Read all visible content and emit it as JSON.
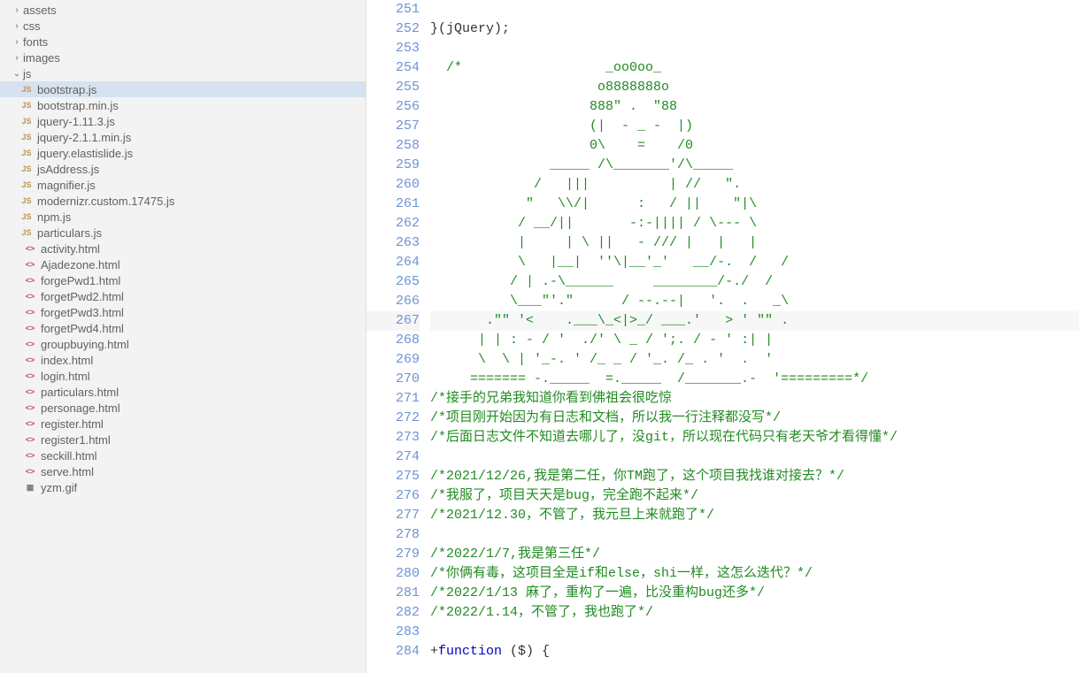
{
  "sidebar": {
    "items": [
      {
        "type": "folder",
        "state": "collapsed",
        "label": "assets",
        "indent": 1
      },
      {
        "type": "folder",
        "state": "collapsed",
        "label": "css",
        "indent": 1
      },
      {
        "type": "folder",
        "state": "collapsed",
        "label": "fonts",
        "indent": 1
      },
      {
        "type": "folder",
        "state": "collapsed",
        "label": "images",
        "indent": 1
      },
      {
        "type": "folder",
        "state": "expanded",
        "label": "js",
        "indent": 1
      },
      {
        "type": "file",
        "icon": "js",
        "label": "bootstrap.js",
        "indent": 2,
        "selected": true
      },
      {
        "type": "file",
        "icon": "js",
        "label": "bootstrap.min.js",
        "indent": 2
      },
      {
        "type": "file",
        "icon": "js",
        "label": "jquery-1.11.3.js",
        "indent": 2
      },
      {
        "type": "file",
        "icon": "js",
        "label": "jquery-2.1.1.min.js",
        "indent": 2
      },
      {
        "type": "file",
        "icon": "js",
        "label": "jquery.elastislide.js",
        "indent": 2
      },
      {
        "type": "file",
        "icon": "js",
        "label": "jsAddress.js",
        "indent": 2
      },
      {
        "type": "file",
        "icon": "js",
        "label": "magnifier.js",
        "indent": 2
      },
      {
        "type": "file",
        "icon": "js",
        "label": "modernizr.custom.17475.js",
        "indent": 2
      },
      {
        "type": "file",
        "icon": "js",
        "label": "npm.js",
        "indent": 2
      },
      {
        "type": "file",
        "icon": "js",
        "label": "particulars.js",
        "indent": 2
      },
      {
        "type": "file",
        "icon": "html",
        "label": "activity.html",
        "indent": 1
      },
      {
        "type": "file",
        "icon": "html",
        "label": "Ajadezone.html",
        "indent": 1
      },
      {
        "type": "file",
        "icon": "html",
        "label": "forgePwd1.html",
        "indent": 1
      },
      {
        "type": "file",
        "icon": "html",
        "label": "forgetPwd2.html",
        "indent": 1
      },
      {
        "type": "file",
        "icon": "html",
        "label": "forgetPwd3.html",
        "indent": 1
      },
      {
        "type": "file",
        "icon": "html",
        "label": "forgetPwd4.html",
        "indent": 1
      },
      {
        "type": "file",
        "icon": "html",
        "label": "groupbuying.html",
        "indent": 1
      },
      {
        "type": "file",
        "icon": "html",
        "label": "index.html",
        "indent": 1
      },
      {
        "type": "file",
        "icon": "html",
        "label": "login.html",
        "indent": 1
      },
      {
        "type": "file",
        "icon": "html",
        "label": "particulars.html",
        "indent": 1
      },
      {
        "type": "file",
        "icon": "html",
        "label": "personage.html",
        "indent": 1
      },
      {
        "type": "file",
        "icon": "html",
        "label": "register.html",
        "indent": 1
      },
      {
        "type": "file",
        "icon": "html",
        "label": "register1.html",
        "indent": 1
      },
      {
        "type": "file",
        "icon": "html",
        "label": "seckill.html",
        "indent": 1
      },
      {
        "type": "file",
        "icon": "html",
        "label": "serve.html",
        "indent": 1
      },
      {
        "type": "file",
        "icon": "img",
        "label": "yzm.gif",
        "indent": 1
      }
    ]
  },
  "editor": {
    "current_line": 267,
    "lines": [
      {
        "n": 251,
        "tokens": [
          {
            "t": "punct",
            "v": ""
          }
        ]
      },
      {
        "n": 252,
        "tokens": [
          {
            "t": "punct",
            "v": "}("
          },
          {
            "t": "ident",
            "v": "jQuery"
          },
          {
            "t": "punct",
            "v": ");"
          }
        ]
      },
      {
        "n": 253,
        "tokens": []
      },
      {
        "n": 254,
        "tokens": [
          {
            "t": "comment",
            "v": "  /*                  _oo0oo_"
          }
        ]
      },
      {
        "n": 255,
        "tokens": [
          {
            "t": "comment",
            "v": "                     o8888888o"
          }
        ]
      },
      {
        "n": 256,
        "tokens": [
          {
            "t": "comment",
            "v": "                    888\" .  \"88"
          }
        ]
      },
      {
        "n": 257,
        "tokens": [
          {
            "t": "comment",
            "v": "                    (|  - _ -  |)"
          }
        ]
      },
      {
        "n": 258,
        "tokens": [
          {
            "t": "comment",
            "v": "                    0\\    =    /0"
          }
        ]
      },
      {
        "n": 259,
        "tokens": [
          {
            "t": "comment",
            "v": "               _____ /\\_______'/\\_____"
          }
        ]
      },
      {
        "n": 260,
        "tokens": [
          {
            "t": "comment",
            "v": "             /   |||          | //   \"."
          }
        ]
      },
      {
        "n": 261,
        "tokens": [
          {
            "t": "comment",
            "v": "            \"   \\\\/|      :   / ||    \"|\\"
          }
        ]
      },
      {
        "n": 262,
        "tokens": [
          {
            "t": "comment",
            "v": "           / __/||       -:-|||| / \\--- \\"
          }
        ]
      },
      {
        "n": 263,
        "tokens": [
          {
            "t": "comment",
            "v": "           |     | \\ ||   - /// |   |   |"
          }
        ]
      },
      {
        "n": 264,
        "tokens": [
          {
            "t": "comment",
            "v": "           \\   |__|  ''\\|__'_'   __/-.  /   /"
          }
        ]
      },
      {
        "n": 263,
        "tokens": []
      }
    ],
    "raw_lines": [
      {
        "n": 251,
        "html": ""
      },
      {
        "n": 252,
        "html": "<span class='tok-punct'>}(</span><span class='tok-ident'>jQuery</span><span class='tok-punct'>);</span>"
      },
      {
        "n": 253,
        "html": ""
      },
      {
        "n": 254,
        "html": "  <span class='tok-comment'>/*                  _oo0oo_</span>"
      },
      {
        "n": 255,
        "html": "  <span class='tok-comment'>                   o8888888o</span>"
      },
      {
        "n": 256,
        "html": "  <span class='tok-comment'>                  888\" .  \"88</span>"
      },
      {
        "n": 257,
        "html": "  <span class='tok-comment'>                  (|  - _ -  |)</span>"
      },
      {
        "n": 258,
        "html": "  <span class='tok-comment'>                  0\\    =    /0</span>"
      },
      {
        "n": 259,
        "html": "  <span class='tok-comment'>             _____ /\\_______'/\\_____</span>"
      },
      {
        "n": 260,
        "html": "  <span class='tok-comment'>           /   |||          | //   \".</span>"
      },
      {
        "n": 261,
        "html": "  <span class='tok-comment'>          \"   \\\\/|      :   / ||    \"|\\</span>"
      },
      {
        "n": 262,
        "html": "  <span class='tok-comment'>         / __/||       -:-|||| / \\--- \\</span>"
      },
      {
        "n": 263,
        "html": "  <span class='tok-comment'>         |     | \\ ||   - /// |   |   |</span>"
      },
      {
        "n": 264,
        "html": "  <span class='tok-comment'>         \\   |__|  ''\\|__'_'   __/-.  /   /</span>"
      },
      {
        "n": 265,
        "html": "  <span class='tok-comment'>        / | .-\\______     ________/-./  /</span>"
      },
      {
        "n": 266,
        "html": "  <span class='tok-comment'>        \\___\"'.\"      / --.--|   '.  .   _\\</span>"
      },
      {
        "n": 267,
        "html": "  <span class='tok-comment'>     .\"\" '&lt;    .___\\_&lt;|&gt;_/ ___.'   &gt; ' \"\" .</span>"
      },
      {
        "n": 268,
        "html": "  <span class='tok-comment'>    | | : - / '  ./' \\ _ / ';. / - ' :| |</span>"
      },
      {
        "n": 269,
        "html": "  <span class='tok-comment'>    \\  \\ | '_-. ' /_ _ / '_. /_ . '  .  '</span>"
      },
      {
        "n": 270,
        "html": "  <span class='tok-comment'>   ======= -._____  =._____  /_______.-  '=========*/</span>"
      },
      {
        "n": 271,
        "html": "<span class='tok-comment'>/*接手的兄弟我知道你看到佛祖会很吃惊</span>"
      },
      {
        "n": 272,
        "html": "<span class='tok-comment'>/*项目刚开始因为有日志和文档，所以我一行注释都没写*/</span>"
      },
      {
        "n": 273,
        "html": "<span class='tok-comment'>/*后面日志文件不知道去哪儿了，没git，所以现在代码只有老天爷才看得懂*/</span>"
      },
      {
        "n": 274,
        "html": ""
      },
      {
        "n": 275,
        "html": "<span class='tok-comment'>/*2021/12/26,我是第二任，你TM跑了，这个项目我找谁对接去？*/</span>"
      },
      {
        "n": 276,
        "html": "<span class='tok-comment'>/*我服了，项目天天是bug，完全跑不起来*/</span>"
      },
      {
        "n": 277,
        "html": "<span class='tok-comment'>/*2021/12.30，不管了，我元旦上来就跑了*/</span>"
      },
      {
        "n": 278,
        "html": ""
      },
      {
        "n": 279,
        "html": "<span class='tok-comment'>/*2022/1/7,我是第三任*/</span>"
      },
      {
        "n": 280,
        "html": "<span class='tok-comment'>/*你俩有毒，这项目全是if和else，shi一样，这怎么迭代？*/</span>"
      },
      {
        "n": 281,
        "html": "<span class='tok-comment'>/*2022/1/13 麻了，重构了一遍，比没重构bug还多*/</span>"
      },
      {
        "n": 282,
        "html": "<span class='tok-comment'>/*2022/1.14，不管了，我也跑了*/</span>"
      },
      {
        "n": 283,
        "html": ""
      },
      {
        "n": 284,
        "html": "<span class='tok-punct'>+</span><span class='tok-keyword'>function </span><span class='tok-punct'>($) {</span>"
      }
    ]
  },
  "icons": {
    "chevron_right": "›",
    "chevron_down": "⌄",
    "js_badge": "JS",
    "html_badge": "<>",
    "img_badge": "▦"
  }
}
